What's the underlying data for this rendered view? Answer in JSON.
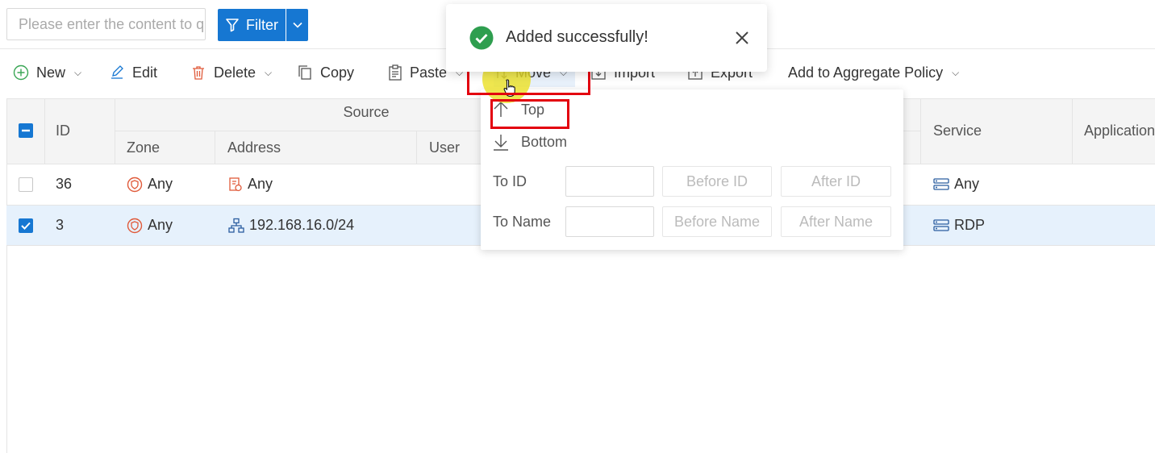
{
  "search": {
    "placeholder": "Please enter the content to q"
  },
  "filter": {
    "label": "Filter"
  },
  "toolbar": {
    "new": "New",
    "edit": "Edit",
    "delete": "Delete",
    "copy": "Copy",
    "paste": "Paste",
    "move": "Move",
    "import": "Import",
    "export": "Export",
    "aggregate": "Add to Aggregate Policy"
  },
  "table": {
    "headers": {
      "id": "ID",
      "source": "Source",
      "zone": "Zone",
      "address": "Address",
      "user": "User",
      "service": "Service",
      "application": "Application"
    },
    "rows": [
      {
        "id": "36",
        "zone": "Any",
        "address": "Any",
        "service": "Any",
        "checked": false
      },
      {
        "id": "3",
        "zone": "Any",
        "address": "192.168.16.0/24",
        "service": "RDP",
        "checked": true
      }
    ]
  },
  "move_menu": {
    "top": "Top",
    "bottom": "Bottom",
    "to_id": "To ID",
    "before_id": "Before ID",
    "after_id": "After ID",
    "to_name": "To Name",
    "before_name": "Before Name",
    "after_name": "After Name"
  },
  "toast": {
    "message": "Added successfully!"
  },
  "colors": {
    "primary": "#1677d2",
    "success": "#2e9e4f",
    "danger": "#e3000f",
    "zone_icon": "#e05a3a"
  }
}
